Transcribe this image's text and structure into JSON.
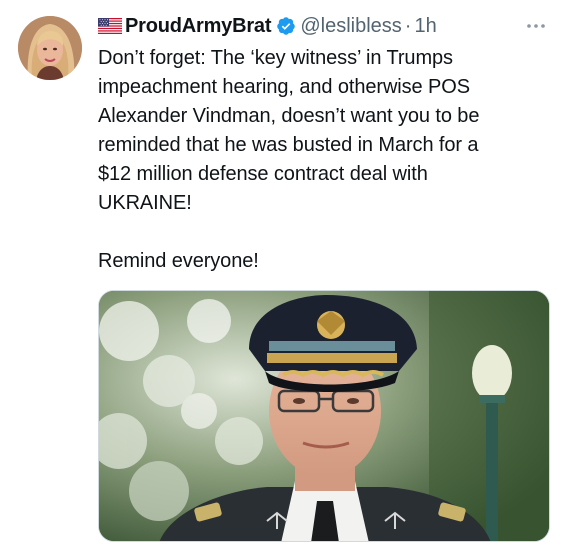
{
  "tweet": {
    "display_name": "ProudArmyBrat",
    "handle": "@leslibless",
    "separator": "·",
    "time": "1h",
    "text_lines": [
      "Don’t forget: The ‘key witness’ in Trumps",
      "impeachment hearing, and otherwise POS",
      "Alexander Vindman, doesn’t want you to be",
      "reminded that he was busted in March for a",
      "$12 million defense contract deal with",
      "UKRAINE!"
    ],
    "text_line2": "Remind everyone!"
  },
  "icons": {
    "flag": "us-flag-icon",
    "verified": "verified-badge-icon",
    "more": "more-options-icon"
  },
  "colors": {
    "verified": "#1d9bf0",
    "secondary_text": "#536471",
    "primary_text": "#0f1419"
  }
}
